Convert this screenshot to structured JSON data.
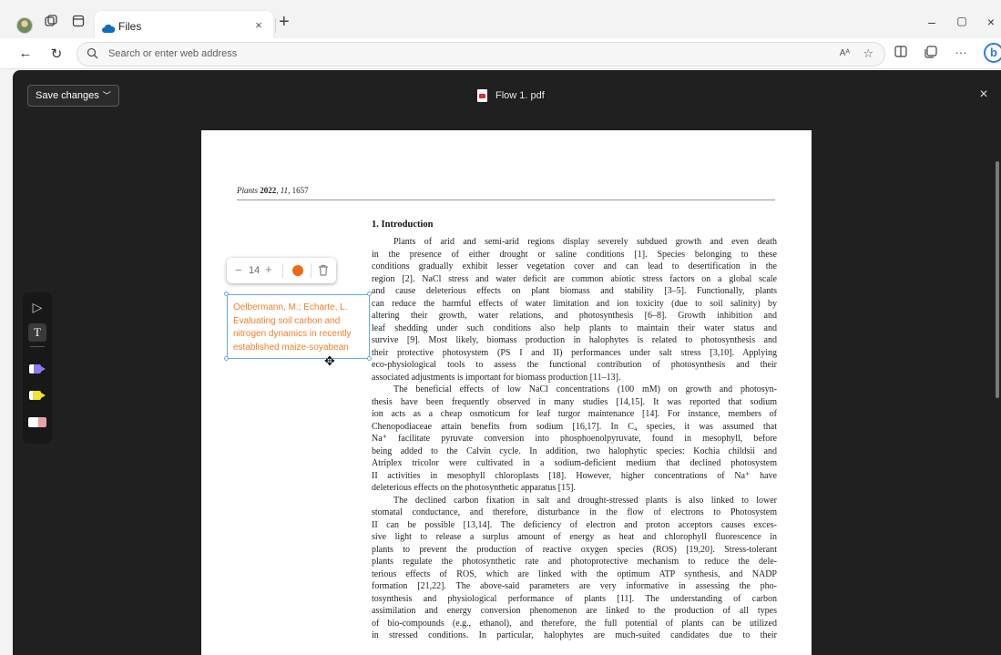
{
  "browser": {
    "tab": {
      "title": "Files",
      "close": "×"
    },
    "new_tab": "+",
    "window_controls": {
      "minimize": "–",
      "maximize": "▢",
      "close": "×"
    },
    "address": {
      "placeholder": "Search or enter web address",
      "read_aloud": "Aᴬ",
      "favorite": "☆"
    },
    "bing_label": "b"
  },
  "viewer": {
    "save_label": "Save changes",
    "file_name": "Flow 1. pdf",
    "close": "×"
  },
  "annotation": {
    "font_size": "14",
    "minus": "−",
    "plus": "+",
    "color": "#ee6a12",
    "lines": [
      "Oelbermann, M.; Echarte, L.",
      "Evaluating soil carbon and",
      "nitrogen dynamics in recently",
      "established maize-soyabean"
    ]
  },
  "draw_tools": {
    "select_glyph": "▷",
    "text_glyph": "T",
    "pen1_color": "#8a7cf0",
    "pen2_color": "#f2e233"
  },
  "document": {
    "journal": "Plants",
    "year": "2022",
    "volume": "11",
    "article": ", 1657",
    "section_title": "1. Introduction",
    "lines": [
      {
        "t": "Plants of arid and semi-arid regions display severely subdued growth and even death",
        "indent": true
      },
      {
        "t": "in the presence of either drought or saline conditions [1]. Species belonging to these"
      },
      {
        "t": "conditions gradually exhibit lesser vegetation cover and can lead to desertification in the"
      },
      {
        "t": "region [2]. NaCl stress and water deficit are common abiotic stress factors on a global scale"
      },
      {
        "t": "and cause deleterious effects on plant biomass and stability [3–5]. Functionally, plants"
      },
      {
        "t": "can reduce the harmful effects of water limitation and ion toxicity (due to soil salinity) by"
      },
      {
        "t": "altering their growth, water relations, and photosynthesis [6–8]. Growth inhibition and"
      },
      {
        "t": "leaf shedding under such conditions also help plants to maintain their water status and"
      },
      {
        "t": "survive [9]. Most likely, biomass production in halophytes is related to photosynthesis and"
      },
      {
        "t": "their protective photosystem (PS I and II) performances under salt stress [3,10]. Applying"
      },
      {
        "t": "eco-physiological tools to assess the functional contribution of photosynthesis and their"
      },
      {
        "t": "associated adjustments is important for biomass production [11–13].",
        "last": true
      },
      {
        "t": "The beneficial effects of low NaCl concentrations (100 mM) on growth and photosyn-",
        "indent": true
      },
      {
        "t": "thesis have been frequently observed in many studies [14,15]. It was reported that sodium"
      },
      {
        "t": "ion acts as a cheap osmoticum for leaf turgor maintenance [14]. For instance, members of"
      },
      {
        "t": "Chenopodiaceae attain benefits from sodium [16,17]. In C₄ species, it was assumed that"
      },
      {
        "t": "Na⁺ facilitate pyruvate conversion into phosphoenolpyruvate, found in mesophyll, before"
      },
      {
        "t": "being added to the Calvin cycle. In addition, two halophytic species: Kochia childsii and"
      },
      {
        "t": "Atriplex tricolor were cultivated in a sodium-deficient medium that declined photosystem"
      },
      {
        "t": "II activities in mesophyll chloroplasts [18]. However, higher concentrations of Na⁺ have"
      },
      {
        "t": "deleterious effects on the photosynthetic apparatus [15].",
        "last": true
      },
      {
        "t": "The declined carbon fixation in salt and drought-stressed plants is also linked to lower",
        "indent": true
      },
      {
        "t": "stomatal conductance, and therefore, disturbance in the flow of electrons to Photosystem"
      },
      {
        "t": "II can be possible [13,14]. The deficiency of electron and proton acceptors causes exces-"
      },
      {
        "t": "sive light to release a surplus amount of energy as heat and chlorophyll fluorescence in"
      },
      {
        "t": "plants to prevent the production of reactive oxygen species (ROS) [19,20]. Stress-tolerant"
      },
      {
        "t": "plants regulate the photosynthetic rate and photoprotective mechanism to reduce the dele-"
      },
      {
        "t": "terious effects of ROS, which are linked with the optimum ATP synthesis, and NADP"
      },
      {
        "t": "formation [21,22]. The above-said parameters are very informative in assessing the pho-"
      },
      {
        "t": "tosynthesis and physiological performance of plants [11]. The understanding of carbon"
      },
      {
        "t": "assimilation and energy conversion phenomenon are linked to the production of all types"
      },
      {
        "t": "of bio-compounds (e.g., ethanol), and therefore, the full potential of plants can be utilized"
      },
      {
        "t": "in stressed conditions. In particular, halophytes are much-suited candidates due to their"
      }
    ]
  }
}
